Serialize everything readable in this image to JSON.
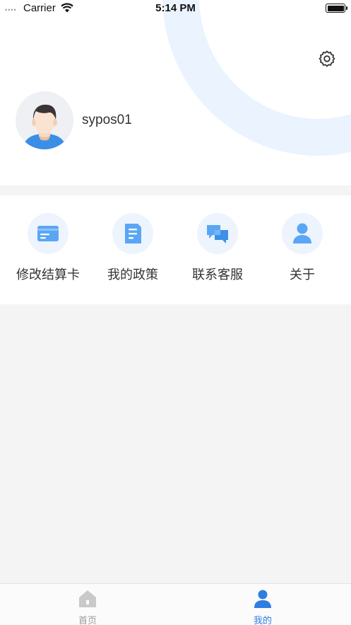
{
  "status_bar": {
    "signal": "••••",
    "carrier": "Carrier",
    "time": "5:14 PM",
    "battery_level": 1.0
  },
  "profile": {
    "username": "sypos01"
  },
  "menu": {
    "items": [
      {
        "label": "修改结算卡",
        "icon": "card-icon"
      },
      {
        "label": "我的政策",
        "icon": "document-icon"
      },
      {
        "label": "联系客服",
        "icon": "chat-icon"
      },
      {
        "label": "关于",
        "icon": "person-icon"
      }
    ]
  },
  "tabbar": {
    "tabs": [
      {
        "label": "首页",
        "icon": "home-icon",
        "active": false
      },
      {
        "label": "我的",
        "icon": "person-icon",
        "active": true
      }
    ]
  },
  "colors": {
    "accent": "#2f7de1",
    "icon_blue": "#5aa6f5",
    "icon_bg": "#edf4fe",
    "inactive": "#9b9b9b"
  }
}
